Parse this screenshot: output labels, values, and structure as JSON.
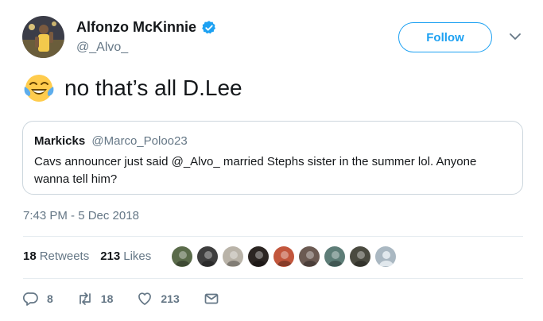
{
  "author": {
    "display_name": "Alfonzo McKinnie",
    "handle": "@_Alvo_",
    "verified": true,
    "avatar_icon": "player-photo-avatar"
  },
  "follow_button": {
    "label": "Follow"
  },
  "tweet": {
    "emoji": "face-with-tears-of-joy",
    "text": "no that’s all D.Lee",
    "timestamp": "7:43 PM - 5 Dec 2018"
  },
  "quoted_tweet": {
    "display_name": "Markicks",
    "handle": "@Marco_Poloo23",
    "text": "Cavs announcer just said @_Alvo_ married Stephs sister in the summer lol. Anyone wanna tell him?"
  },
  "stats": {
    "retweets_count": "18",
    "retweets_label": "Retweets",
    "likes_count": "213",
    "likes_label": "Likes"
  },
  "likers": [
    {
      "color": "#5a6b4a"
    },
    {
      "color": "#3e3e3e"
    },
    {
      "color": "#b9b3a8"
    },
    {
      "color": "#2b2522"
    },
    {
      "color": "#c2563c"
    },
    {
      "color": "#6b5a52"
    },
    {
      "color": "#5d7d77"
    },
    {
      "color": "#4a4a40"
    },
    {
      "color": "#aab8c2"
    }
  ],
  "actions": {
    "replies": "8",
    "retweets": "18",
    "likes": "213"
  },
  "colors": {
    "accent": "#1da1f2",
    "secondary_text": "#657786",
    "border": "#ccd6dd"
  }
}
